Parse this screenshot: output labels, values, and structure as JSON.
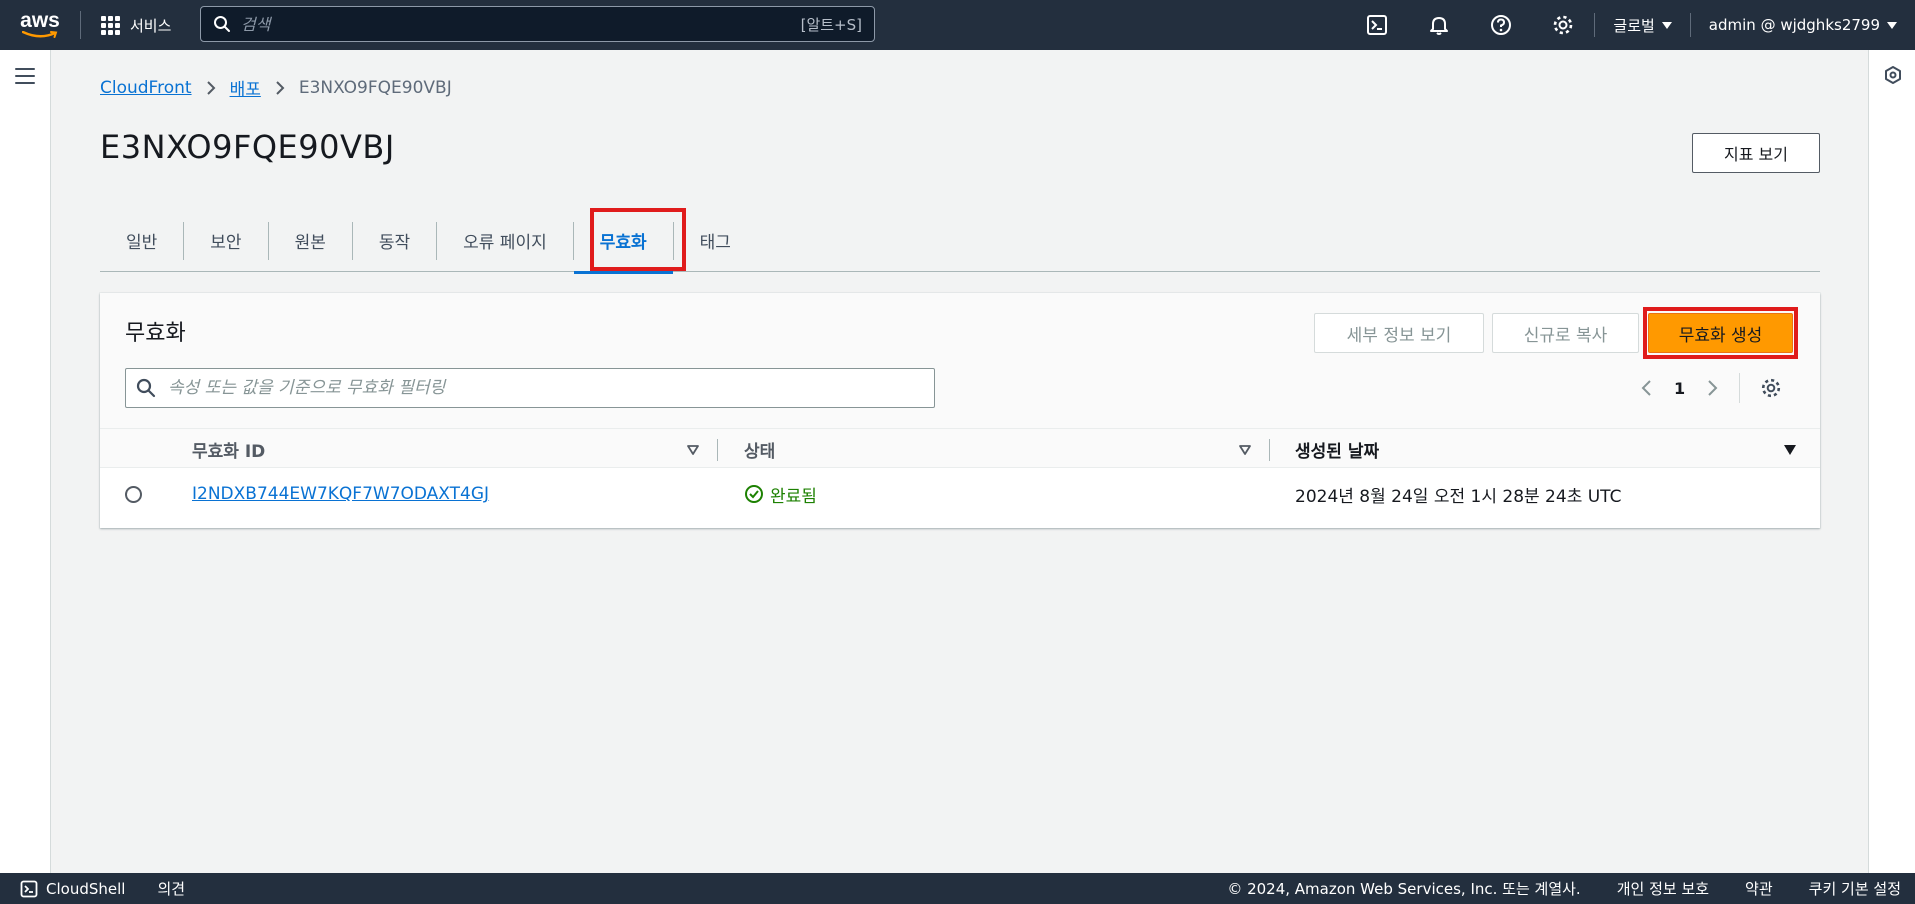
{
  "topnav": {
    "logo_text": "aws",
    "services_label": "서비스",
    "search_placeholder": "검색",
    "search_shortcut": "[알트+S]",
    "region_label": "글로벌",
    "account_label": "admin @ wjdghks2799"
  },
  "breadcrumb": {
    "items": [
      "CloudFront",
      "배포"
    ],
    "current": "E3NXO9FQE90VBJ"
  },
  "page": {
    "title": "E3NXO9FQE90VBJ",
    "metrics_button": "지표 보기"
  },
  "tabs": [
    {
      "label": "일반",
      "active": false
    },
    {
      "label": "보안",
      "active": false
    },
    {
      "label": "원본",
      "active": false
    },
    {
      "label": "동작",
      "active": false
    },
    {
      "label": "오류 페이지",
      "active": false
    },
    {
      "label": "무효화",
      "active": true
    },
    {
      "label": "태그",
      "active": false
    }
  ],
  "panel": {
    "title": "무효화",
    "details_button": "세부 정보 보기",
    "copy_button": "신규로 복사",
    "create_button": "무효화 생성",
    "filter_placeholder": "속성 또는 값을 기준으로 무효화 필터링",
    "page_number": "1"
  },
  "table": {
    "columns": [
      "무효화 ID",
      "상태",
      "생성된 날짜"
    ],
    "rows": [
      {
        "id": "I2NDXB744EW7KQF7W7ODAXT4GJ",
        "status": "완료됨",
        "created": "2024년 8월 24일 오전 1시 28분 24초 UTC"
      }
    ]
  },
  "footer": {
    "cloudshell": "CloudShell",
    "feedback": "의견",
    "copyright": "© 2024, Amazon Web Services, Inc. 또는 계열사.",
    "privacy": "개인 정보 보호",
    "terms": "약관",
    "cookies": "쿠키 기본 설정"
  },
  "colors": {
    "nav_bg": "#232f3e",
    "accent": "#0972d3",
    "primary_button": "#ff9900",
    "success": "#1d8102",
    "highlight": "#e01b1b"
  }
}
